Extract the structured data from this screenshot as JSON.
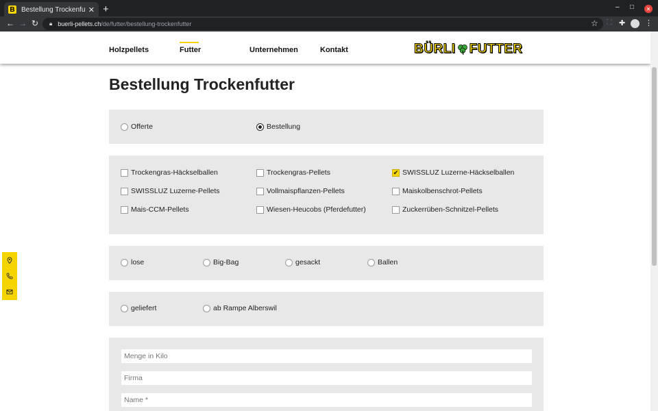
{
  "browser": {
    "tab_title": "Bestellung Trockenfutter",
    "favicon_letter": "B",
    "url_host": "buerli-pellets.ch",
    "url_path": "/de/futter/bestellung-trockenfutter"
  },
  "nav": {
    "items": [
      "Holzpellets",
      "Futter",
      "Unternehmen",
      "Kontakt"
    ],
    "active": "Futter"
  },
  "logo": {
    "left": "BÜRLI",
    "right": "FUTTER"
  },
  "page": {
    "title": "Bestellung Trockenfutter"
  },
  "request_type": {
    "options": [
      {
        "label": "Offerte",
        "selected": false
      },
      {
        "label": "Bestellung",
        "selected": true
      }
    ]
  },
  "products": {
    "items": [
      {
        "label": "Trockengras-Häckselballen",
        "checked": false
      },
      {
        "label": "Trockengras-Pellets",
        "checked": false
      },
      {
        "label": "SWISSLUZ Luzerne-Häckselballen",
        "checked": true
      },
      {
        "label": "SWISSLUZ Luzerne-Pellets",
        "checked": false
      },
      {
        "label": "Vollmaispflanzen-Pellets",
        "checked": false
      },
      {
        "label": "Maiskolbenschrot-Pellets",
        "checked": false
      },
      {
        "label": "Mais-CCM-Pellets",
        "checked": false
      },
      {
        "label": "Wiesen-Heucobs (Pferdefutter)",
        "checked": false
      },
      {
        "label": "Zuckerrüben-Schnitzel-Pellets",
        "checked": false
      }
    ]
  },
  "packaging": {
    "options": [
      {
        "label": "lose",
        "selected": false
      },
      {
        "label": "Big-Bag",
        "selected": false
      },
      {
        "label": "gesackt",
        "selected": false
      },
      {
        "label": "Ballen",
        "selected": false
      }
    ]
  },
  "delivery": {
    "options": [
      {
        "label": "geliefert",
        "selected": false
      },
      {
        "label": "ab Rampe Alberswil",
        "selected": false
      }
    ]
  },
  "form": {
    "quantity_placeholder": "Menge in Kilo",
    "company_placeholder": "Firma",
    "name_placeholder": "Name *"
  },
  "colors": {
    "accent": "#f5d400",
    "panel": "#e8e8e8"
  },
  "icons": [
    "location-icon",
    "phone-icon",
    "mail-icon"
  ]
}
